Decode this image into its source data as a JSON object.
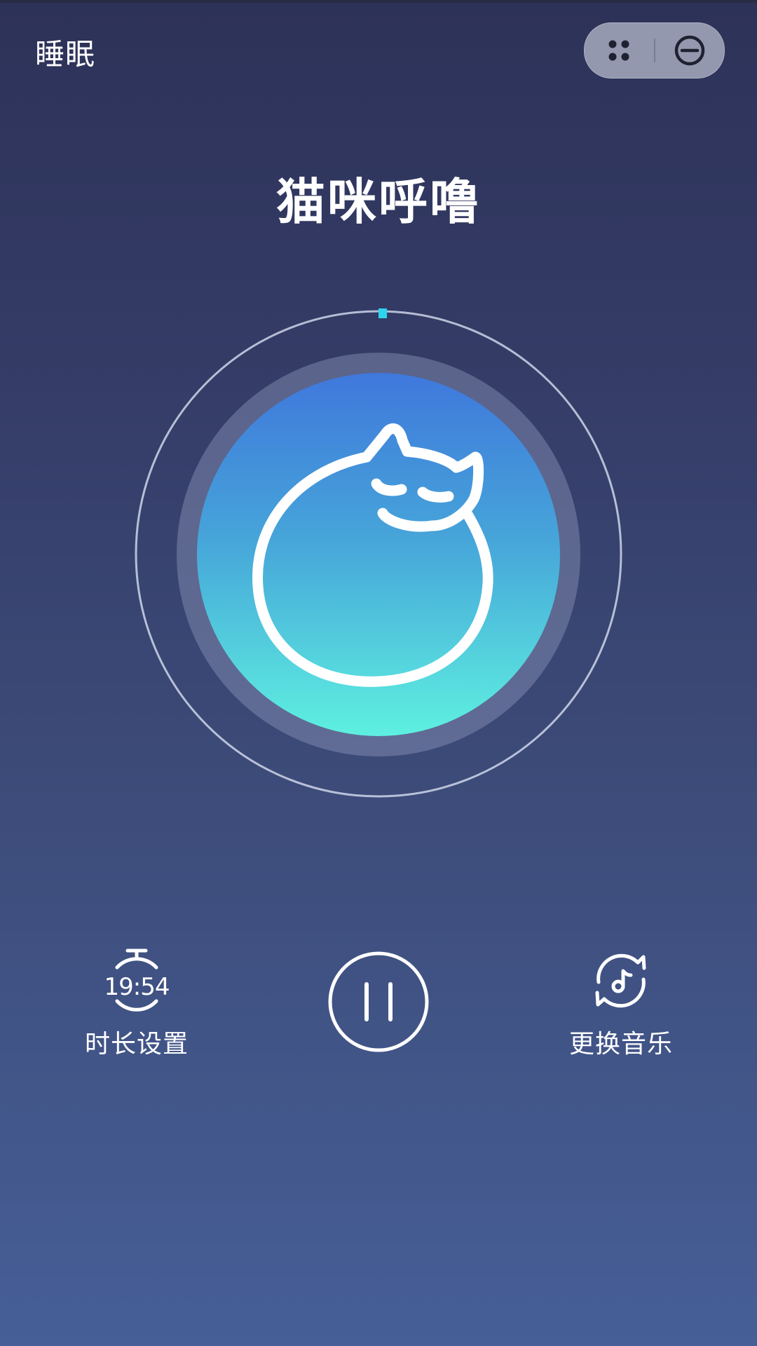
{
  "header": {
    "title": "睡眠"
  },
  "capsule": {
    "more_icon": "four-dots-icon",
    "close_icon": "minus-circle-icon"
  },
  "player": {
    "sound_name": "猫咪呼噜",
    "progress_fraction": 0.01,
    "colors": {
      "accent": "#2ed3f0",
      "disc_top": "#3f78dc",
      "disc_bottom": "#5ef0e0"
    },
    "artwork_icon": "sleeping-cat-icon"
  },
  "controls": {
    "timer": {
      "time": "19:54",
      "label": "时长设置",
      "icon": "stopwatch-icon"
    },
    "playback": {
      "icon": "pause-icon",
      "state": "playing"
    },
    "change_music": {
      "label": "更换音乐",
      "icon": "music-refresh-icon"
    }
  }
}
